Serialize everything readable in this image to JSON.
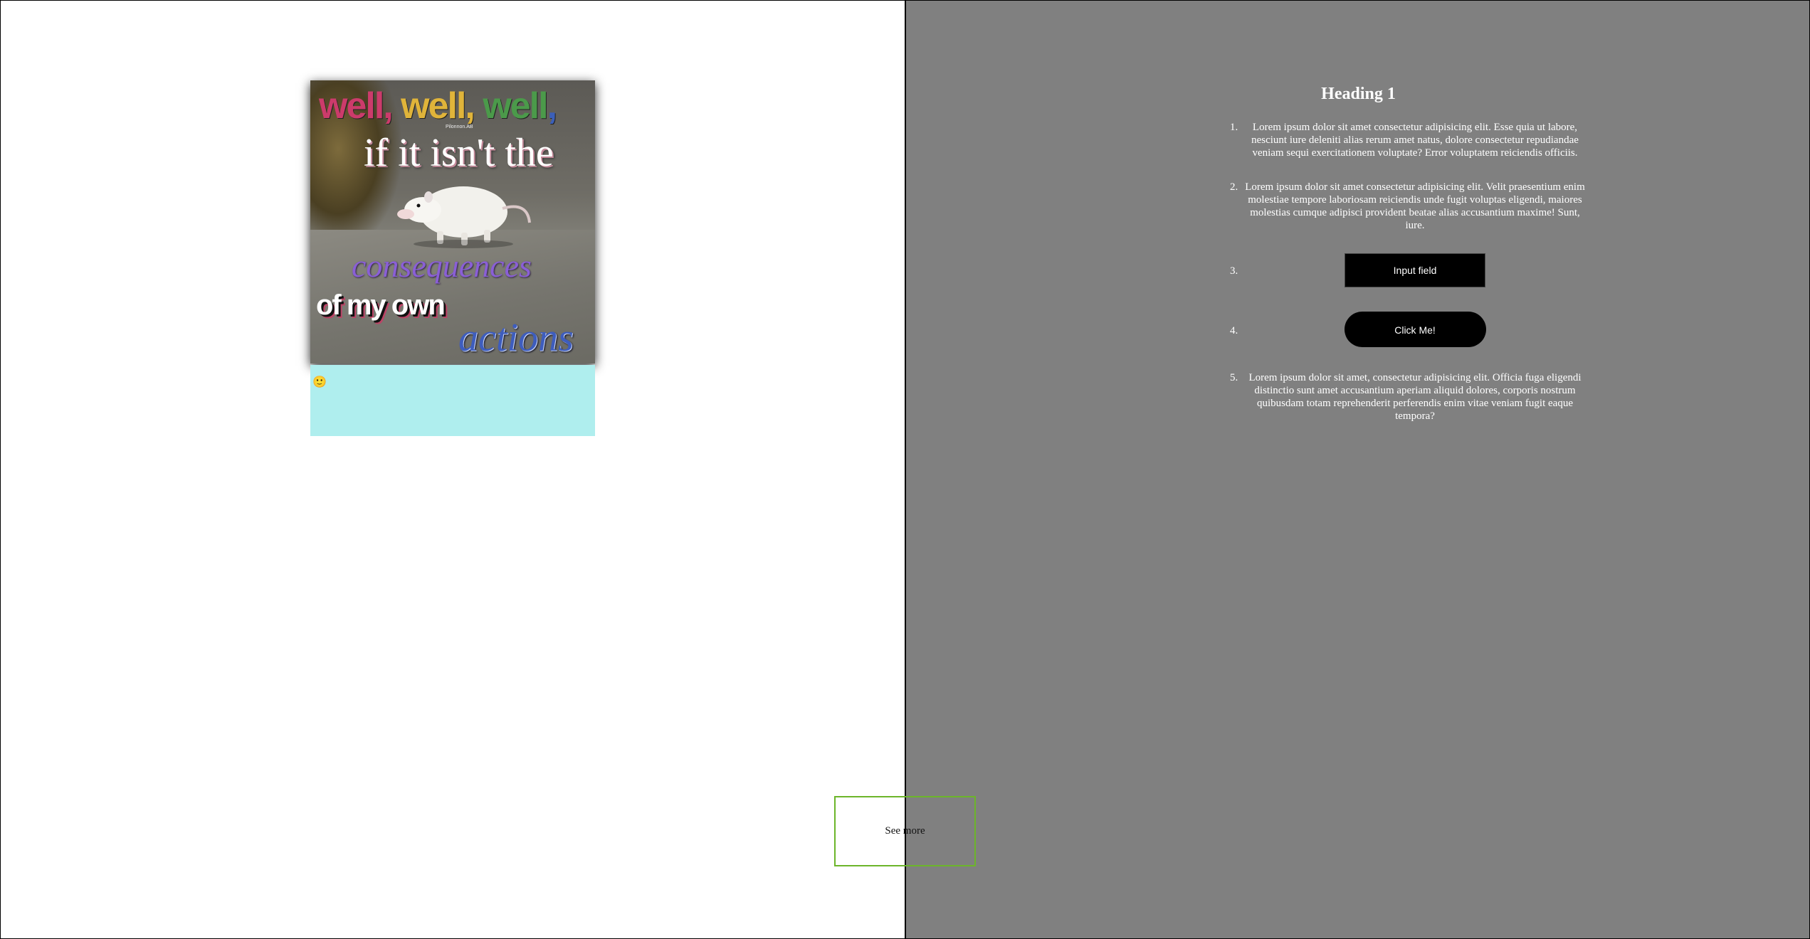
{
  "meme": {
    "line1": [
      "well, ",
      "well, ",
      "well",
      ","
    ],
    "watermark": "Pilonnon.AB",
    "line2": "if it isn't the",
    "line3": "consequences",
    "line4": "of my own",
    "line5": "actions"
  },
  "caption": {
    "emoji": "🙂"
  },
  "see_more": {
    "label": "See more"
  },
  "panel": {
    "heading": "Heading 1",
    "items": [
      {
        "text": "Lorem ipsum dolor sit amet consectetur adipisicing elit. Esse quia ut labore, nesciunt iure deleniti alias rerum amet natus, dolore consectetur repudiandae veniam sequi exercitationem voluptate? Error voluptatem reiciendis officiis."
      },
      {
        "text": "Lorem ipsum dolor sit amet consectetur adipisicing elit. Velit praesentium enim molestiae tempore laboriosam reiciendis unde fugit voluptas eligendi, maiores molestias cumque adipisci provident beatae alias accusantium maxime! Sunt, iure."
      },
      {
        "input_label": "Input field"
      },
      {
        "button_label": "Click Me!"
      },
      {
        "text": "Lorem ipsum dolor sit amet, consectetur adipisicing elit. Officia fuga eligendi distinctio sunt amet accusantium aperiam aliquid dolores, corporis nostrum quibusdam totam reprehenderit perferendis enim vitae veniam fugit eaque tempora?"
      }
    ]
  },
  "colors": {
    "right_panel_bg": "#808080",
    "caption_bg": "#afeeee",
    "see_more_border": "#6cb52a",
    "widget_bg": "#000000"
  }
}
